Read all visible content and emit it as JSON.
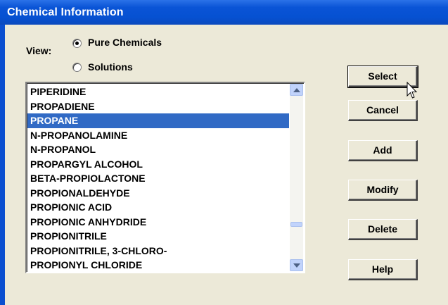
{
  "window": {
    "title": "Chemical Information"
  },
  "view": {
    "label": "View:",
    "options": [
      {
        "label": "Pure Chemicals",
        "selected": true
      },
      {
        "label": "Solutions",
        "selected": false
      }
    ]
  },
  "list": {
    "items": [
      "PIPERIDINE",
      "PROPADIENE",
      "PROPANE",
      "N-PROPANOLAMINE",
      "N-PROPANOL",
      "PROPARGYL ALCOHOL",
      "BETA-PROPIOLACTONE",
      "PROPIONALDEHYDE",
      "PROPIONIC ACID",
      "PROPIONIC ANHYDRIDE",
      "PROPIONITRILE",
      "PROPIONITRILE, 3-CHLORO-",
      "PROPIONYL CHLORIDE"
    ],
    "selected_item": "PROPANE"
  },
  "buttons": {
    "select": "Select",
    "cancel": "Cancel",
    "add": "Add",
    "modify": "Modify",
    "delete": "Delete",
    "help": "Help"
  },
  "icons": {
    "scroll_up": "scroll-up-arrow",
    "scroll_down": "scroll-down-arrow",
    "cursor": "mouse-pointer"
  },
  "colors": {
    "titlebar": "#0a54d6",
    "selection": "#316ac5",
    "dialog_bg": "#ece9d8"
  }
}
